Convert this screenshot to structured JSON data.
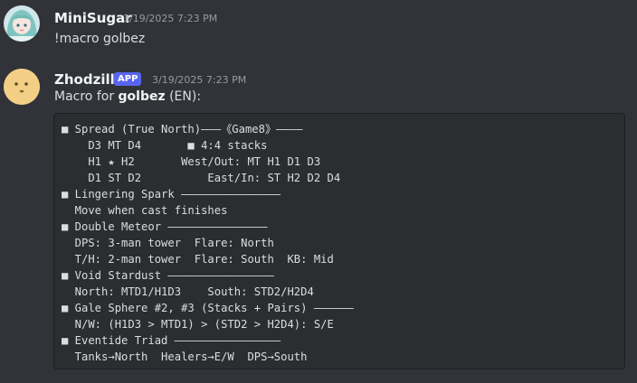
{
  "messages": [
    {
      "avatar": "anime-girl-avatar",
      "username": "MiniSugar",
      "timestamp": "3/19/2025 7:23 PM",
      "text": "!macro golbez"
    },
    {
      "avatar": "smiley-face-avatar",
      "username": "Zhodzilla",
      "badge": "APP",
      "timestamp": "3/19/2025 7:23 PM",
      "text_prefix": "Macro for ",
      "text_bold": "golbez",
      "text_suffix": " (EN):",
      "code_lines": [
        "■ Spread (True North)———《Game8》————",
        "    D3 MT D4       ■ 4:4 stacks",
        "    H1 ★ H2       West/Out: MT H1 D1 D3",
        "    D1 ST D2          East/In: ST H2 D2 D4",
        "■ Lingering Spark ———————————————",
        "  Move when cast finishes",
        "■ Double Meteor ———————————————",
        "  DPS: 3-man tower  Flare: North",
        "  T/H: 2-man tower  Flare: South  KB: Mid",
        "■ Void Stardust ————————————————",
        "  North: MTD1/H1D3    South: STD2/H2D4",
        "■ Gale Sphere #2, #3 (Stacks + Pairs) ——————",
        "  N/W: (H1D3 > MTD1) > (STD2 > H2D4): S/E",
        "■ Eventide Triad ————————————————",
        "  Tanks→North  Healers→E/W  DPS→South"
      ]
    }
  ],
  "colors": {
    "background": "#313338",
    "code_background": "#2b2d31",
    "app_badge": "#5865f2",
    "username": "#f2f3f5",
    "timestamp": "#949ba4"
  }
}
